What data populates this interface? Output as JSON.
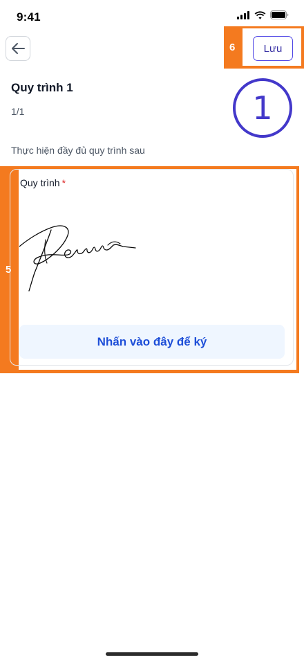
{
  "status_bar": {
    "time": "9:41"
  },
  "header": {
    "save_label": "Lưu"
  },
  "annotations": {
    "save_region": "6",
    "signature_region": "5",
    "step": "1"
  },
  "page": {
    "title": "Quy trình 1",
    "count": "1/1",
    "instruction": "Thực hiện đầy đủ quy trình sau"
  },
  "signature_field": {
    "label": "Quy trình",
    "required_mark": "*",
    "sign_button_label": "Nhấn vào đây để ký"
  },
  "colors": {
    "annotation": "#f47a1f",
    "accent": "#4f46e5",
    "sign_button_bg": "#eff6ff",
    "sign_button_text": "#1d4ed8"
  }
}
